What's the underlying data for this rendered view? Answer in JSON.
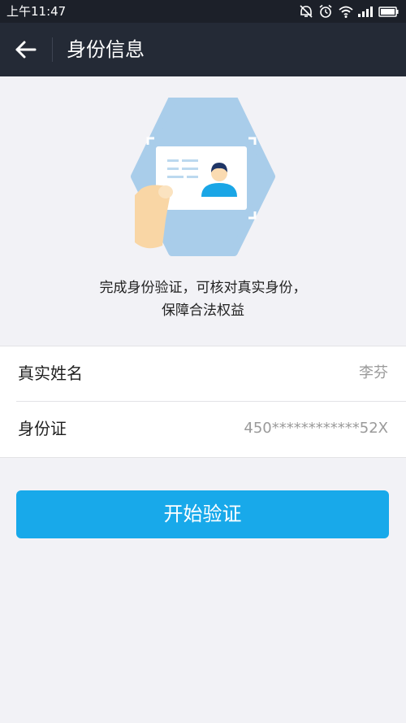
{
  "status_bar": {
    "time": "上午11:47",
    "icons": [
      "alarm-off-icon",
      "alarm-clock-icon",
      "wifi-icon",
      "signal-icon",
      "battery-icon"
    ]
  },
  "nav": {
    "title": "身份信息",
    "back_icon": "back-arrow-icon"
  },
  "hero": {
    "illustration": "id-card-verification-illustration",
    "colors": {
      "hexagon": "#a9cdea",
      "card": "#ffffff",
      "accent": "#1aa6e6",
      "hand": "#f9d6a5"
    }
  },
  "description": {
    "line1": "完成身份验证，可核对真实身份，",
    "line2": "保障合法权益"
  },
  "form": {
    "name_label": "真实姓名",
    "name_value": "李芬",
    "id_label": "身份证",
    "id_value": "450************52X"
  },
  "button": {
    "label": "开始验证",
    "color": "#18a9ea"
  }
}
